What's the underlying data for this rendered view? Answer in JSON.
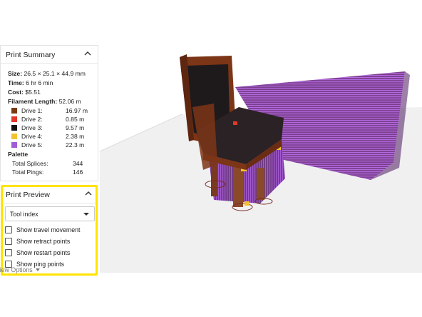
{
  "colors": {
    "drive1": "#7a3a10",
    "drive2": "#e2382a",
    "drive3": "#111111",
    "drive4": "#f2c230",
    "drive5": "#a25cd6",
    "highlight": "#ffe400"
  },
  "summary": {
    "title": "Print Summary",
    "size_label": "Size:",
    "size_value": "26.5 × 25.1 × 44.9 mm",
    "time_label": "Time:",
    "time_value": "6 hr 6 min",
    "cost_label": "Cost:",
    "cost_value": "$5.51",
    "filament_label": "Filament Length:",
    "filament_value": "52.06 m",
    "drives": [
      {
        "label": "Drive 1:",
        "value": "16.97 m",
        "color": "#7a3a10"
      },
      {
        "label": "Drive 2:",
        "value": "0.85 m",
        "color": "#e2382a"
      },
      {
        "label": "Drive 3:",
        "value": "9.57 m",
        "color": "#111111"
      },
      {
        "label": "Drive 4:",
        "value": "2.38 m",
        "color": "#f2c230"
      },
      {
        "label": "Drive 5:",
        "value": "22.3 m",
        "color": "#a25cd6"
      }
    ],
    "palette_title": "Palette",
    "splices_label": "Total Splices:",
    "splices_value": "344",
    "pings_label": "Total Pings:",
    "pings_value": "146"
  },
  "preview": {
    "title": "Print Preview",
    "mode_selected": "Tool index",
    "checkboxes": [
      {
        "label": "Show travel movement",
        "checked": false
      },
      {
        "label": "Show retract points",
        "checked": false
      },
      {
        "label": "Show restart points",
        "checked": false
      },
      {
        "label": "Show ping points",
        "checked": false
      }
    ]
  },
  "view_options_label": "View Options"
}
